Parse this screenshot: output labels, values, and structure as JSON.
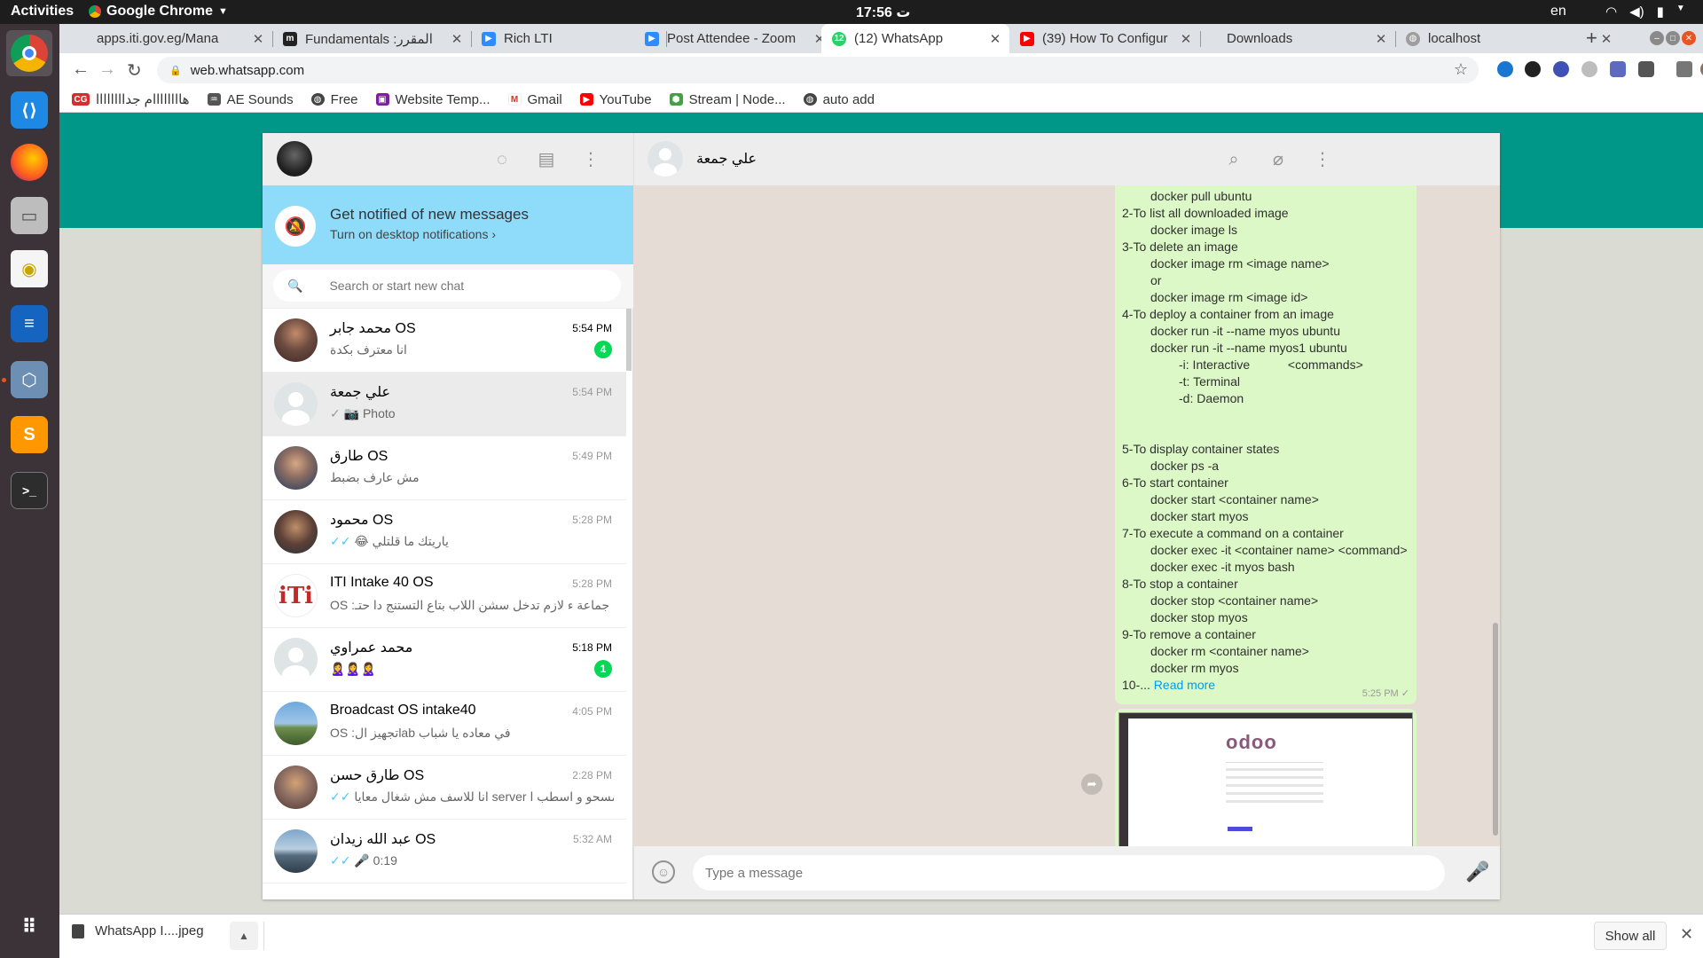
{
  "topbar": {
    "activities": "Activities",
    "app_name": "Google Chrome",
    "clock": "17:56 ت",
    "lang": "en"
  },
  "browser": {
    "tabs": [
      {
        "title": "apps.iti.gov.eg/Mana",
        "icon": "page-icon",
        "active": false
      },
      {
        "title": "Fundamentals :المقرر",
        "icon": "moodle-icon",
        "active": false
      },
      {
        "title": "Rich LTI",
        "icon": "zoom-icon",
        "active": false
      },
      {
        "title": "Post Attendee - Zoom",
        "icon": "zoom-icon",
        "active": false
      },
      {
        "title": "(12) WhatsApp",
        "icon": "whatsapp-icon",
        "active": true
      },
      {
        "title": "(39) How To Configur",
        "icon": "youtube-icon",
        "active": false
      },
      {
        "title": "Downloads",
        "icon": "downloads-icon",
        "active": false
      },
      {
        "title": "localhost",
        "icon": "globe-icon",
        "active": false
      }
    ],
    "url": "web.whatsapp.com",
    "bookmarks": [
      {
        "label": "هاااااااام جداااااااا",
        "icon": "cg-icon"
      },
      {
        "label": "AE Sounds",
        "icon": "waveform-icon"
      },
      {
        "label": "Free",
        "icon": "globe-icon"
      },
      {
        "label": "Website Temp...",
        "icon": "template-icon"
      },
      {
        "label": "Gmail",
        "icon": "gmail-icon"
      },
      {
        "label": "YouTube",
        "icon": "youtube-icon"
      },
      {
        "label": "Stream | Node...",
        "icon": "node-icon"
      },
      {
        "label": "auto add",
        "icon": "globe-icon"
      }
    ]
  },
  "whatsapp": {
    "notify": {
      "title": "Get notified of new messages",
      "subtitle": "Turn on desktop notifications ›"
    },
    "search_placeholder": "Search or start new chat",
    "chats": [
      {
        "name": "محمد جابر OS",
        "time": "5:54 PM",
        "preview": "انا معترف بكدة",
        "unread": "4",
        "avatar": "photo",
        "ticks": ""
      },
      {
        "name": "علي جمعة",
        "time": "5:54 PM",
        "preview": "📷 Photo",
        "unread": "",
        "avatar": "default",
        "ticks": "✓",
        "tick_class": "grey"
      },
      {
        "name": "طارق OS",
        "time": "5:49 PM",
        "preview": "مش عارف بضبط",
        "unread": "",
        "avatar": "photo",
        "ticks": ""
      },
      {
        "name": "محمود OS",
        "time": "5:28 PM",
        "preview": "😂 ياريتك ما قلتلي",
        "unread": "",
        "avatar": "photo",
        "ticks": "✓✓",
        "tick_class": "blue"
      },
      {
        "name": "ITI Intake 40 OS",
        "time": "5:28 PM",
        "preview": "OS :نور ايمن جماعة ء لازم تدخل سشن اللاب بتاع التستنج دا حتـ...",
        "unread": "",
        "avatar": "iti",
        "ticks": ""
      },
      {
        "name": "محمد عمراوي",
        "time": "5:18 PM",
        "preview": "🙎‍♀️🙎‍♀️🙎‍♀️",
        "unread": "1",
        "avatar": "default",
        "ticks": ""
      },
      {
        "name": "Broadcast OS intake40",
        "time": "4:05 PM",
        "preview": "OS :تجهيز الlab في معاده يا شباب",
        "unread": "",
        "avatar": "photo",
        "ticks": ""
      },
      {
        "name": "طارق حسن OS",
        "time": "2:28 PM",
        "preview": "انا للاسف مش شغال معايا server فشكلي همسحو و اسطب ا...",
        "unread": "",
        "avatar": "photo",
        "ticks": "✓✓",
        "tick_class": "blue"
      },
      {
        "name": "عبد الله زيدان OS",
        "time": "5:32 AM",
        "preview": "🎤 0:19",
        "unread": "",
        "avatar": "photo",
        "ticks": "✓✓",
        "tick_class": "blue"
      }
    ],
    "contact_name": "علي جمعة",
    "message_lines": [
      {
        "text": "docker pull ubuntu",
        "indent": 1
      },
      {
        "text": "2-To list all downloaded image",
        "indent": 0
      },
      {
        "text": "docker image ls",
        "indent": 1
      },
      {
        "text": "3-To delete an image",
        "indent": 0
      },
      {
        "text": "docker image rm <image name>",
        "indent": 1
      },
      {
        "text": "or",
        "indent": 1
      },
      {
        "text": "docker image rm <image id>",
        "indent": 1
      },
      {
        "text": "4-To deploy a container from an image",
        "indent": 0
      },
      {
        "text": "docker run -it --name myos ubuntu",
        "indent": 1
      },
      {
        "text": "docker run -it --name myos1 ubuntu",
        "indent": 1
      },
      {
        "text": "-i: Interactive           <commands>",
        "indent": 2
      },
      {
        "text": "-t: Terminal",
        "indent": 2
      },
      {
        "text": "-d: Daemon",
        "indent": 2
      },
      {
        "text": "",
        "indent": 0
      },
      {
        "text": "",
        "indent": 0
      },
      {
        "text": "5-To display container states",
        "indent": 0
      },
      {
        "text": "docker ps -a",
        "indent": 1
      },
      {
        "text": "6-To start container",
        "indent": 0
      },
      {
        "text": "docker start <container name>",
        "indent": 1
      },
      {
        "text": "docker start myos",
        "indent": 1
      },
      {
        "text": "7-To execute a command on a container",
        "indent": 0
      },
      {
        "text": "docker exec -it <container name> <command>",
        "indent": 1
      },
      {
        "text": "docker exec -it myos bash",
        "indent": 1
      },
      {
        "text": "8-To stop a container",
        "indent": 0
      },
      {
        "text": "docker stop <container name>",
        "indent": 1
      },
      {
        "text": "docker stop myos",
        "indent": 1
      },
      {
        "text": "9-To remove a container",
        "indent": 0
      },
      {
        "text": "docker rm <container name>",
        "indent": 1
      },
      {
        "text": "docker rm myos",
        "indent": 1
      }
    ],
    "message_last_prefix": "10-...",
    "read_more": "Read more",
    "message_time": "5:25 PM ✓",
    "image_logo": "odoo",
    "compose_placeholder": "Type a message"
  },
  "downloads": {
    "file": "WhatsApp I....jpeg",
    "show_all": "Show all"
  },
  "colors": {
    "teal": "#009688",
    "bubble": "#dcf8c6",
    "notify": "#8fdbfa",
    "unread": "#06d755"
  }
}
